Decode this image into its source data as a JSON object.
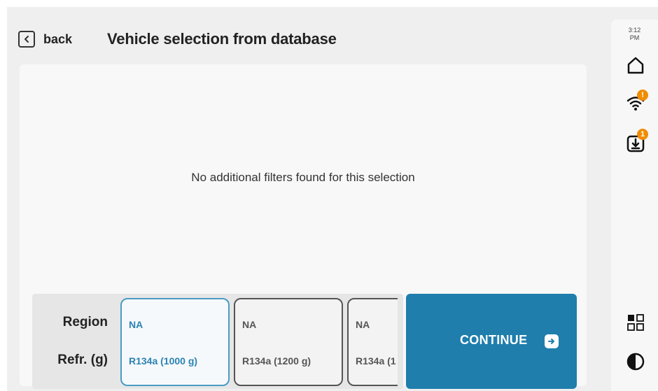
{
  "header": {
    "back_label": "back",
    "title": "Vehicle selection from database"
  },
  "main": {
    "empty_message": "No additional filters found for this selection"
  },
  "filters": {
    "region_label": "Region",
    "refr_label": "Refr. (g)",
    "options": [
      {
        "region": "NA",
        "refrigerant": "R134a (1000 g)",
        "selected": true
      },
      {
        "region": "NA",
        "refrigerant": "R134a (1200 g)",
        "selected": false
      },
      {
        "region": "NA",
        "refrigerant": "R134a (1",
        "selected": false
      }
    ]
  },
  "continue": {
    "label": "CONTINUE",
    "icon": "arrow-right-icon"
  },
  "sidebar": {
    "time": "3:12",
    "ampm": "PM",
    "wifi_badge": "!",
    "download_badge": "1"
  },
  "colors": {
    "accent": "#1f7eac",
    "selected_option": "#2b82b4",
    "badge": "#f08c00"
  }
}
